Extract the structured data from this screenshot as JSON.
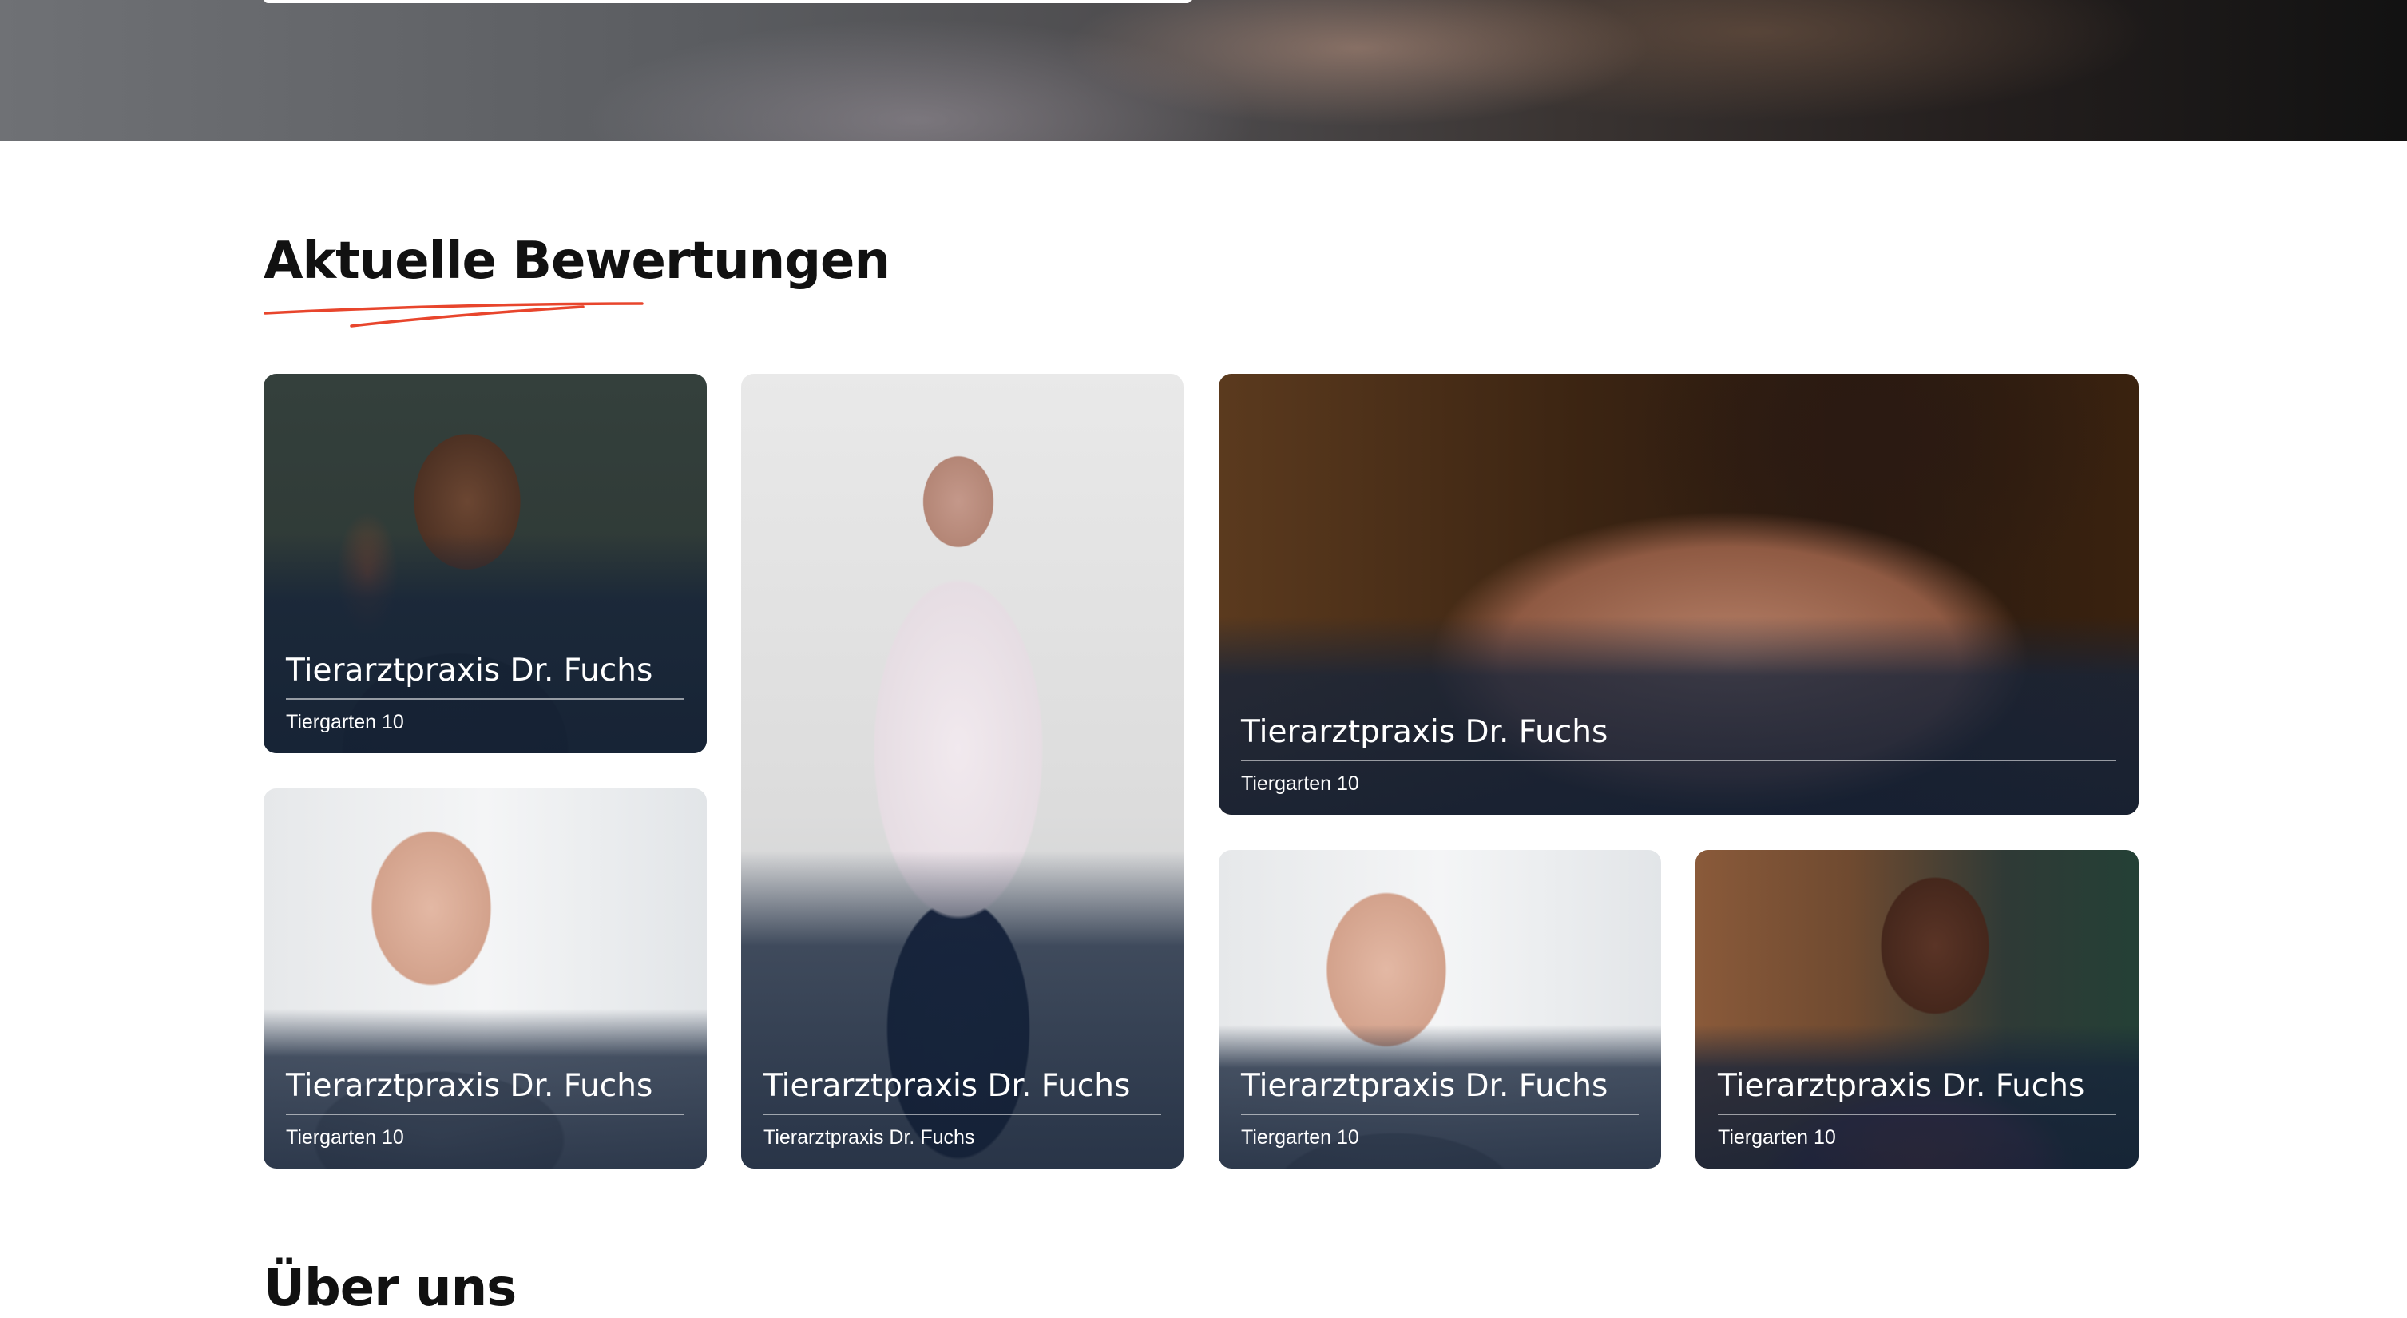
{
  "reviews_section": {
    "title": "Aktuelle Bewertungen",
    "accent_color": "#e8452c",
    "cards": [
      {
        "name": "Tierarztpraxis Dr. Fuchs",
        "address": "Tiergarten 10"
      },
      {
        "name": "Tierarztpraxis Dr. Fuchs",
        "address": "Tierarztpraxis Dr. Fuchs"
      },
      {
        "name": "Tierarztpraxis Dr. Fuchs",
        "address": "Tiergarten 10"
      },
      {
        "name": "Tierarztpraxis Dr. Fuchs",
        "address": "Tiergarten 10"
      },
      {
        "name": "Tierarztpraxis Dr. Fuchs",
        "address": "Tiergarten 10"
      },
      {
        "name": "Tierarztpraxis Dr. Fuchs",
        "address": "Tiergarten 10"
      }
    ]
  },
  "about_section": {
    "title": "Über uns"
  }
}
